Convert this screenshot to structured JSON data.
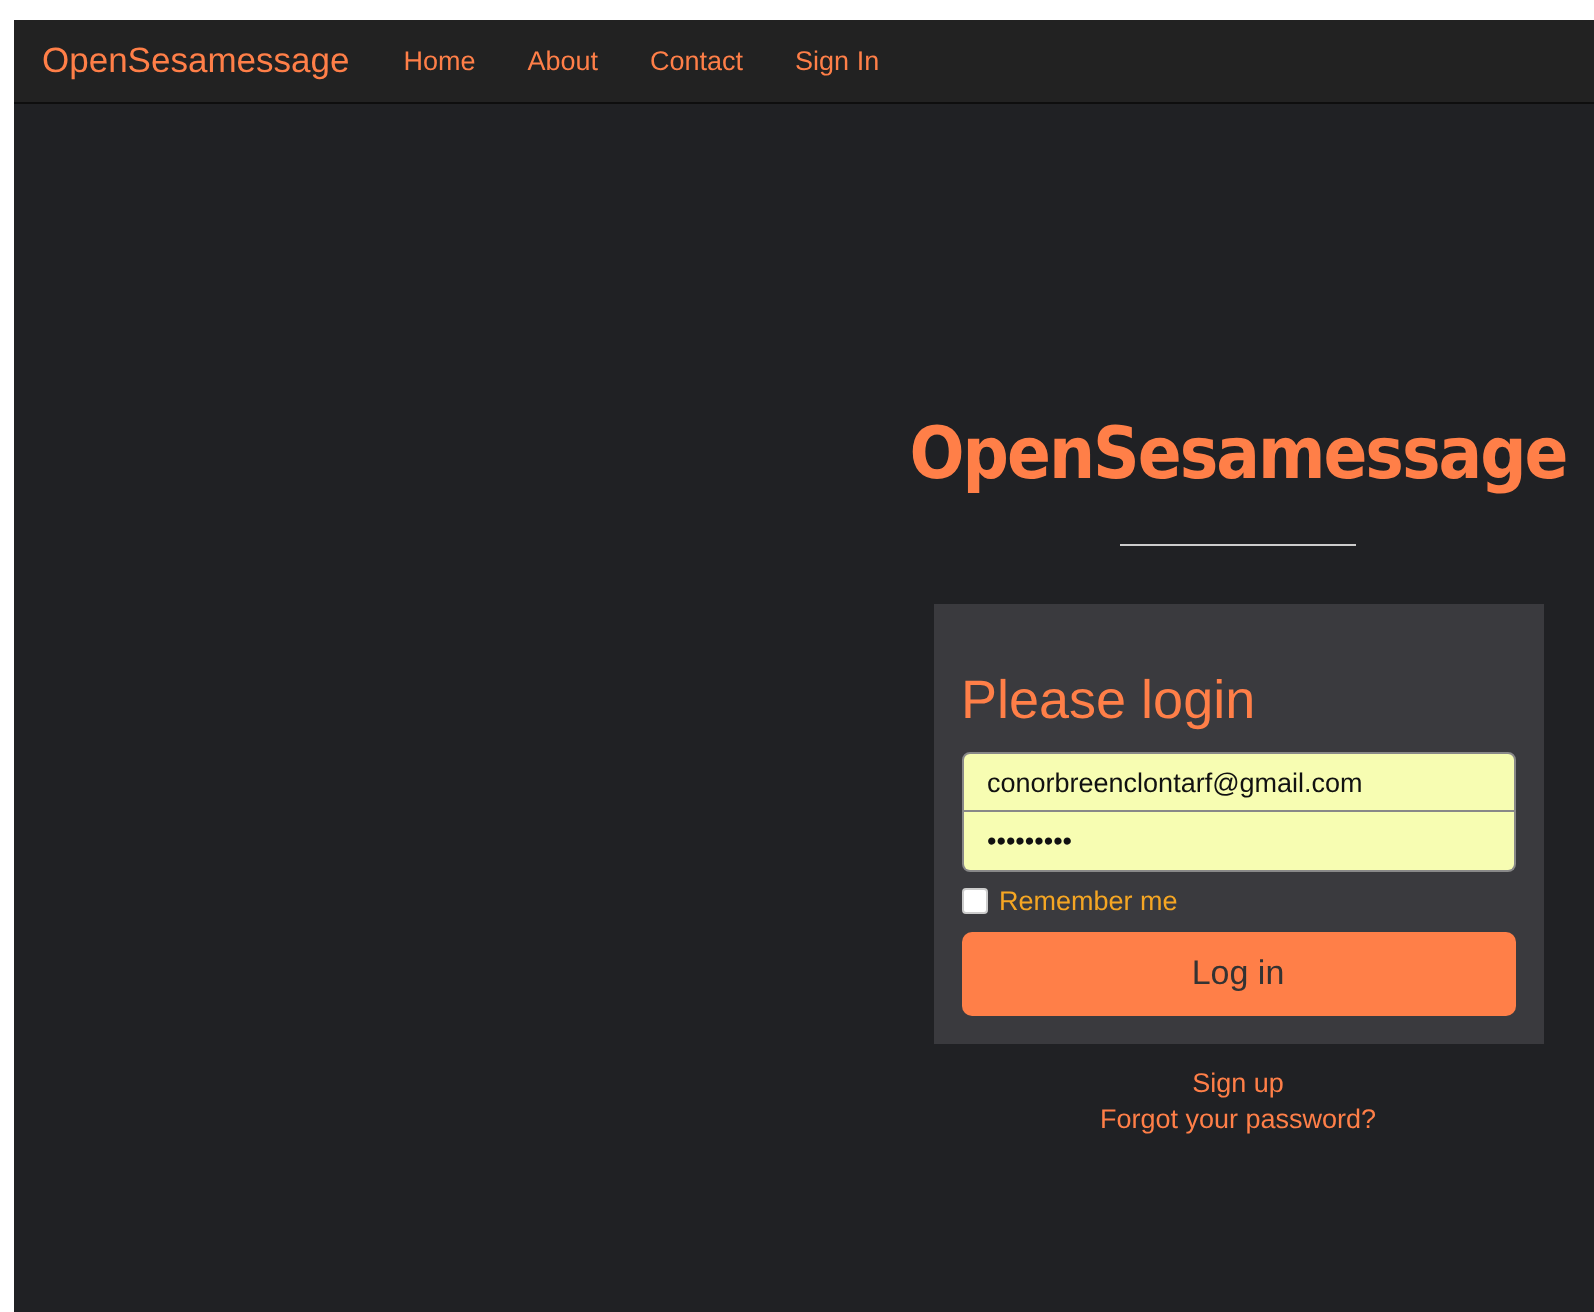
{
  "navbar": {
    "brand": "OpenSesamessage",
    "links": [
      {
        "label": "Home"
      },
      {
        "label": "About"
      },
      {
        "label": "Contact"
      },
      {
        "label": "Sign In"
      }
    ]
  },
  "hero": {
    "title": "OpenSesamessage"
  },
  "login": {
    "heading": "Please login",
    "email": {
      "value": "conorbreenclontarf@gmail.com"
    },
    "password": {
      "value": "•••••••••"
    },
    "remember": {
      "label": "Remember me",
      "checked": false
    },
    "button": "Log in"
  },
  "links": [
    {
      "label": "Sign up"
    },
    {
      "label": "Forgot your password?"
    }
  ]
}
